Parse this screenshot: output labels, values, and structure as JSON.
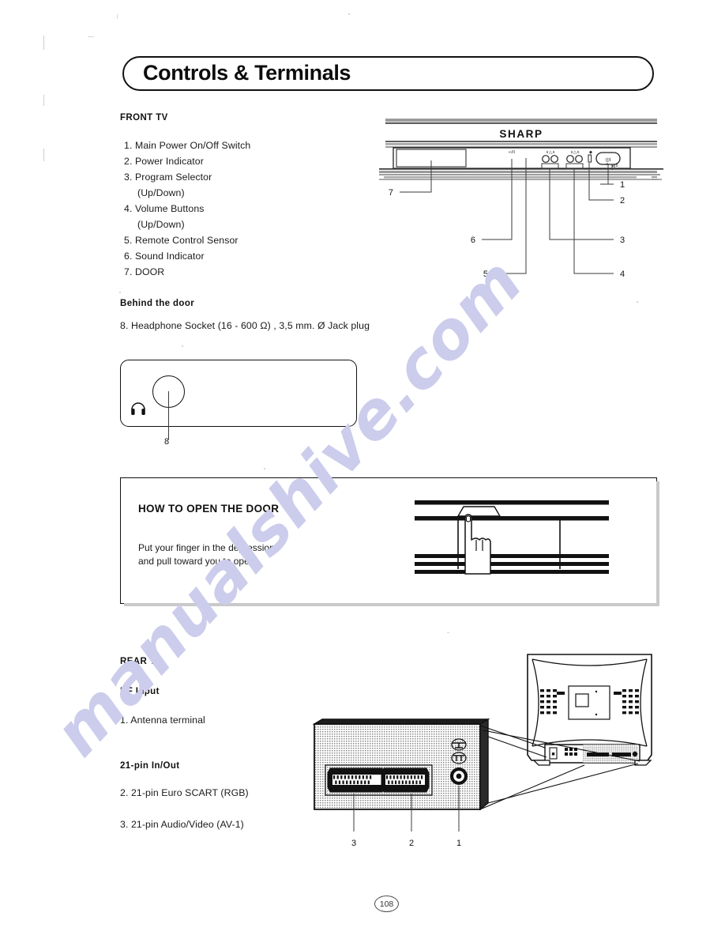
{
  "page": {
    "title": "Controls & Terminals",
    "number": "108"
  },
  "watermark": {
    "text": "manualshive.com",
    "color": "#ccccec"
  },
  "front_tv": {
    "heading": "FRONT TV",
    "items": [
      {
        "num": "1.",
        "label": "Main Power On/Off Switch",
        "sub": ""
      },
      {
        "num": "2.",
        "label": "Power Indicator",
        "sub": ""
      },
      {
        "num": "3.",
        "label": "Program Selector",
        "sub": "(Up/Down)"
      },
      {
        "num": "4.",
        "label": "Volume Buttons",
        "sub": "(Up/Down)"
      },
      {
        "num": "5.",
        "label": "Remote Control Sensor",
        "sub": ""
      },
      {
        "num": "6.",
        "label": "Sound Indicator",
        "sub": ""
      },
      {
        "num": "7.",
        "label": "DOOR",
        "sub": ""
      }
    ],
    "brand_logo": "SHARP",
    "callouts": [
      "1",
      "2",
      "3",
      "4",
      "5",
      "6",
      "7"
    ]
  },
  "behind_door": {
    "heading": "Behind the door",
    "item": "8. Headphone Socket   (16  - 600 Ω) , 3,5 mm. Ø Jack plug",
    "callout": "8",
    "icon": "headphone-icon"
  },
  "how_to_open": {
    "title": "HOW TO OPEN THE DOOR",
    "line1": "Put your finger in the depression",
    "line2": "and pull toward you to open."
  },
  "rear_tv": {
    "heading": "REAR TV",
    "rf_heading": "RF Input",
    "rf_item": "1. Antenna terminal",
    "pin_heading": "21-pin In/Out",
    "pin_items": [
      "2. 21-pin Euro SCART (RGB)",
      "3. 21-pin Audio/Video (AV-1)"
    ],
    "callouts": [
      "1",
      "2",
      "3"
    ]
  }
}
